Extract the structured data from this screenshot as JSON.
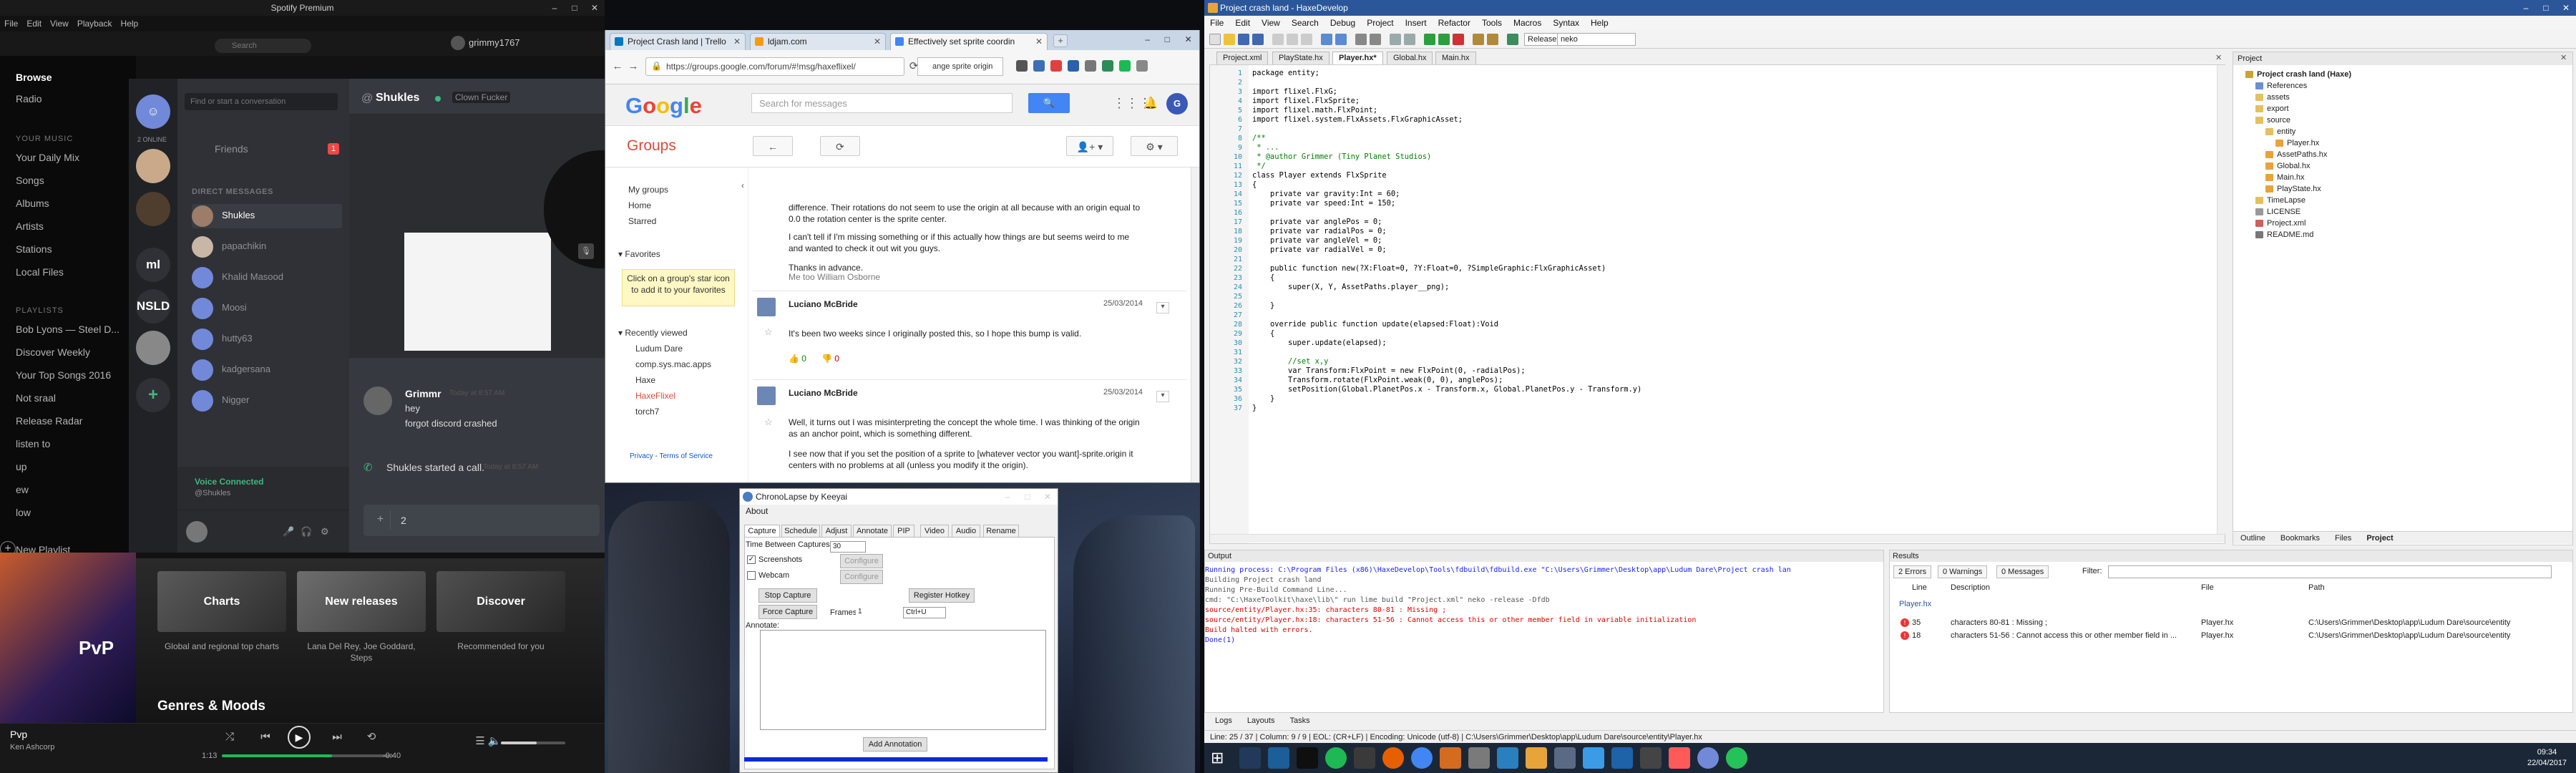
{
  "spotify": {
    "title": "Spotify Premium",
    "menu": [
      "File",
      "Edit",
      "View",
      "Playback",
      "Help"
    ],
    "search_placeholder": "Search",
    "username": "grimmy1767",
    "nav": [
      "Browse",
      "Radio"
    ],
    "library_header": "YOUR MUSIC",
    "library": [
      "Your Daily Mix",
      "Songs",
      "Albums",
      "Artists",
      "Stations",
      "Local Files"
    ],
    "playlists_header": "PLAYLISTS",
    "playlists": [
      "Bob Lyons — Steel D...",
      "Discover Weekly",
      "Your Top Songs 2016",
      "Not sraal",
      "Release Radar",
      "listen to",
      "up",
      "ew",
      "low"
    ],
    "new_playlist": "New Playlist",
    "tiles": [
      {
        "title": "Charts",
        "caption": "Global and regional top charts"
      },
      {
        "title": "New releases",
        "caption": "Lana Del Rey, Joe Goddard, Steps"
      },
      {
        "title": "Discover",
        "caption": "Recommended for you"
      }
    ],
    "genres_heading": "Genres & Moods",
    "album_text": "PvP",
    "now_playing": {
      "track": "Pvp",
      "artist": "Ken Ashcorp",
      "elapsed": "1:13",
      "duration": "-0:40",
      "progress": 0.64,
      "volume": 0.55
    },
    "accent": "#1db954"
  },
  "discord": {
    "search_placeholder": "Find or start a conversation",
    "friends_label": "Friends",
    "friends_badge": "1",
    "dm_header": "DIRECT MESSAGES",
    "dms": [
      "Shukles",
      "papachikin",
      "Khalid Masood",
      "Moosi",
      "hutty63",
      "kadgersana",
      "Nigger"
    ],
    "guild_labels": [
      "ml",
      "NSLD"
    ],
    "online_count": "2 ONLINE",
    "voice_status": "Voice Connected",
    "voice_channel": "@Shukles",
    "chat": {
      "name": "Shukles",
      "status": "Clown Fucker",
      "author": "Grimmr",
      "time": "Today at 8:57 AM",
      "messages": [
        "hey",
        "forgot discord crashed"
      ],
      "call_event": "Shukles started a call.",
      "call_time": "Today at 8:57 AM",
      "input_value": "2"
    }
  },
  "chrome": {
    "tabs": [
      {
        "label": "Project Crash land | Trello",
        "color": "#0079bf"
      },
      {
        "label": "ldjam.com",
        "color": "#f39c12"
      },
      {
        "label": "Effectively set sprite coordin",
        "color": "#4285f4"
      }
    ],
    "url": "https://groups.google.com/forum/#!msg/haxeflixel/",
    "find_text": "ange sprite origin",
    "search_placeholder": "Search for messages",
    "avatar_letter": "G",
    "groups_label": "Groups",
    "left_nav": [
      "My groups",
      "Home",
      "Starred"
    ],
    "favorites_label": "Favorites",
    "favorites_tip": "Click on a group's star icon to add it to your favorites",
    "recent_label": "Recently viewed",
    "recent": [
      "Ludum Dare",
      "comp.sys.mac.apps",
      "Haxe",
      "HaxeFlixel",
      "torch7"
    ],
    "privacy": "Privacy - Terms of Service",
    "thread_top": [
      "difference. Their rotations do not seem to use the origin at all because with an origin equal to",
      "0.0 the rotation center is the sprite center.",
      "I can't tell if I'm missing something or if this actually how things are but seems weird to me",
      "and wanted to check it out wit you guys.",
      "Thanks in advance."
    ],
    "me_too": "Me too William Osborne",
    "posts": [
      {
        "author": "Luciano McBride",
        "date": "25/03/2014",
        "body": [
          "It's been two weeks since I originally posted this, so I hope this bump is valid."
        ],
        "plus": "0",
        "minus": "0"
      },
      {
        "author": "Luciano McBride",
        "date": "25/03/2014",
        "body": [
          "Well, it turns out I was misinterpreting the concept the whole time. I was thinking of the origin",
          "as an anchor point, which is something different.",
          "",
          "I see now that if you set the position of a sprite to [whatever vector you want]-sprite.origin it",
          "centers with no problems at all (unless you modify it the origin)."
        ]
      }
    ]
  },
  "chronolapse": {
    "title": "ChronoLapse by Keeyai",
    "menu": [
      "About"
    ],
    "tabs": [
      "Capture",
      "Schedule",
      "Adjust",
      "Annotate",
      "PIP",
      "Video",
      "Audio",
      "Rename"
    ],
    "time_between_label": "Time Between Captures:",
    "time_between_value": "30",
    "screenshots_label": "Screenshots",
    "webcam_label": "Webcam",
    "configure_label": "Configure",
    "stop_capture": "Stop Capture",
    "force_capture": "Force Capture",
    "register_hotkey": "Register Hotkey",
    "frames_label": "Frames:",
    "frames_value": "1",
    "hotkey_value": "Ctrl+U",
    "annotate_label": "Annotate:",
    "add_annotation": "Add Annotation"
  },
  "haxedevelop": {
    "title": "Project crash land - HaxeDevelop",
    "menu": [
      "File",
      "Edit",
      "View",
      "Search",
      "Debug",
      "Project",
      "Insert",
      "Refactor",
      "Tools",
      "Macros",
      "Syntax",
      "Help"
    ],
    "config": "Release",
    "target": "neko",
    "editor_tabs": [
      "Project.xml",
      "PlayState.hx",
      "Player.hx*",
      "Global.hx",
      "Main.hx"
    ],
    "code_lines": [
      "package entity;",
      "",
      "import flixel.FlxG;",
      "import flixel.FlxSprite;",
      "import flixel.math.FlxPoint;",
      "import flixel.system.FlxAssets.FlxGraphicAsset;",
      "",
      "/**",
      " * ...",
      " * @author Grimmer (Tiny Planet Studios)",
      " */",
      "class Player extends FlxSprite",
      "{",
      "    private var gravity:Int = 60;",
      "    private var speed:Int = 150;",
      "",
      "    private var anglePos = 0;",
      "    private var radialPos = 0;",
      "    private var angleVel = 0;",
      "    private var radialVel = 0;",
      "",
      "    public function new(?X:Float=0, ?Y:Float=0, ?SimpleGraphic:FlxGraphicAsset)",
      "    {",
      "        super(X, Y, AssetPaths.player__png);",
      "",
      "    }",
      "",
      "    override public function update(elapsed:Float):Void",
      "    {",
      "        super.update(elapsed);",
      "",
      "        //set x,y",
      "        var Transform:FlxPoint = new FlxPoint(0, -radialPos);",
      "        Transform.rotate(FlxPoint.weak(0, 0), anglePos);",
      "        setPosition(Global.PlanetPos.x - Transform.x, Global.PlanetPos.y - Transform.y)",
      "    }",
      "}"
    ],
    "project_header": "Project",
    "project_tree": [
      {
        "label": "Project crash land (Haxe)",
        "depth": 0,
        "bold": true
      },
      {
        "label": "References",
        "depth": 1
      },
      {
        "label": "assets",
        "depth": 1
      },
      {
        "label": "export",
        "depth": 1
      },
      {
        "label": "source",
        "depth": 1
      },
      {
        "label": "entity",
        "depth": 2
      },
      {
        "label": "Player.hx",
        "depth": 3
      },
      {
        "label": "AssetPaths.hx",
        "depth": 2
      },
      {
        "label": "Global.hx",
        "depth": 2
      },
      {
        "label": "Main.hx",
        "depth": 2
      },
      {
        "label": "PlayState.hx",
        "depth": 2
      },
      {
        "label": "TimeLapse",
        "depth": 1
      },
      {
        "label": "LICENSE",
        "depth": 1
      },
      {
        "label": "Project.xml",
        "depth": 1
      },
      {
        "label": "README.md",
        "depth": 1
      }
    ],
    "project_tabs": [
      "Outline",
      "Bookmarks",
      "Files",
      "Project"
    ],
    "output_header": "Output",
    "output_lines": [
      {
        "text": "Running process: C:\\Program Files (x86)\\HaxeDevelop\\Tools\\fdbuild\\fdbuild.exe \"C:\\Users\\Grimmer\\Desktop\\app\\Ludum Dare\\Project crash lan",
        "color": "#1a1aff"
      },
      {
        "text": "Building Project crash land",
        "color": "#555"
      },
      {
        "text": "Running Pre-Build Command Line...",
        "color": "#555"
      },
      {
        "text": "cmd: \"C:\\HaxeToolkit\\haxe\\lib\\\" run lime build \"Project.xml\" neko -release -Dfdb",
        "color": "#555"
      },
      {
        "text": "source/entity/Player.hx:35: characters 80-81 : Missing ;",
        "color": "#e00000"
      },
      {
        "text": "source/entity/Player.hx:18: characters 51-56 : Cannot access this or other member field in variable initialization",
        "color": "#e00000"
      },
      {
        "text": "Build halted with errors.",
        "color": "#e00000"
      },
      {
        "text": "Done(1)",
        "color": "#1a1aff"
      }
    ],
    "results_header": "Results",
    "results_filters": [
      "2 Errors",
      "0 Warnings",
      "0 Messages"
    ],
    "results_filter_label": "Filter:",
    "results_columns": [
      "Line",
      "Description",
      "File",
      "Path"
    ],
    "results_group": "Player.hx",
    "results": [
      {
        "line": "35",
        "desc": "characters 80-81 : Missing ;",
        "file": "Player.hx",
        "path": "C:\\Users\\Grimmer\\Desktop\\app\\Ludum Dare\\source\\entity"
      },
      {
        "line": "18",
        "desc": "characters 51-56 : Cannot access this or other member field in ...",
        "file": "Player.hx",
        "path": "C:\\Users\\Grimmer\\Desktop\\app\\Ludum Dare\\source\\entity"
      }
    ],
    "bottom_tabs": [
      "Logs",
      "Layouts",
      "Tasks"
    ],
    "status": "Line: 25 / 37  |  Column: 9 / 9  |  EOL: (CR+LF)  |  Encoding: Unicode (utf-8)  |  C:\\Users\\Grimmer\\Desktop\\app\\Ludum Dare\\source\\entity\\Player.hx"
  },
  "taskbar": {
    "time": "09:34",
    "date": "22/04/2017"
  }
}
